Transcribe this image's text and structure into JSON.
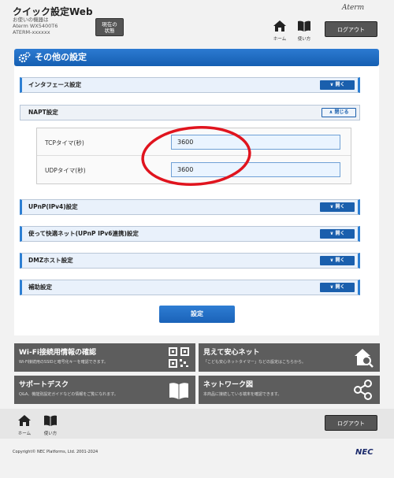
{
  "header": {
    "app_title": "クイック設定Web",
    "device_line1": "お使いの機器は",
    "device_line2": "Aterm WX5400T6",
    "device_line3": "ATERM-xxxxxx",
    "status_button_line1": "現在の",
    "status_button_line2": "状態",
    "brand": "Aterm",
    "home_label": "ホーム",
    "help_label": "使い方",
    "logout_label": "ログアウト"
  },
  "section": {
    "title": "その他の設定"
  },
  "accordions": {
    "interface": {
      "label": "インタフェース設定",
      "toggle": "開く"
    },
    "napt": {
      "label": "NAPT設定",
      "toggle": "閉じる"
    },
    "upnp": {
      "label": "UPnP(IPv4)設定",
      "toggle": "開く"
    },
    "upnp6": {
      "label": "使って快適ネット(UPnP IPv6連携)設定",
      "toggle": "開く"
    },
    "dmz": {
      "label": "DMZホスト設定",
      "toggle": "開く"
    },
    "assist": {
      "label": "補助設定",
      "toggle": "開く"
    }
  },
  "napt": {
    "tcp_label": "TCPタイマ(秒)",
    "tcp_value": "3600",
    "udp_label": "UDPタイマ(秒)",
    "udp_value": "3600"
  },
  "submit_label": "設定",
  "tiles": {
    "wifi": {
      "title": "Wi-Fi接続用情報の確認",
      "desc": "Wi-Fi接続用のSSIDと暗号化キーを確認できます。"
    },
    "safety": {
      "title": "見えて安心ネット",
      "desc": "「こども安心ネットタイマー」などの設定はこちらから。"
    },
    "support": {
      "title": "サポートデスク",
      "desc": "Q&A、機能別設定ガイドなどの情報をご覧になれます。"
    },
    "network": {
      "title": "ネットワーク図",
      "desc": "本商品に接続している端末を確認できます。"
    }
  },
  "footer": {
    "home_label": "ホーム",
    "help_label": "使い方",
    "logout_label": "ログアウト",
    "copyright": "Copyright© NEC Platforms, Ltd. 2001-2024",
    "nec": "NEC"
  },
  "colors": {
    "accent": "#1a5fad",
    "annotation": "#e0141e"
  }
}
